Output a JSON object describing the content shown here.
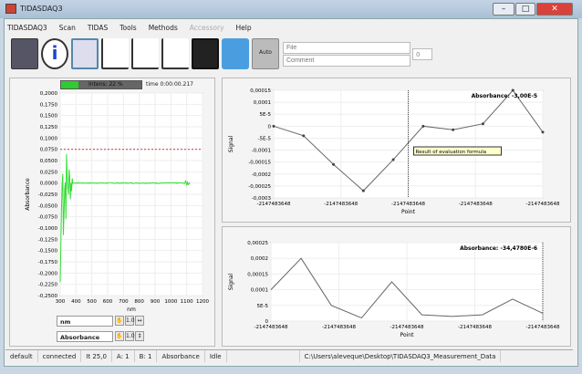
{
  "window": {
    "title": "TIDASDAQ3",
    "minimize": "–",
    "maximize": "□",
    "close": "✕",
    "close_color": "#d9423a"
  },
  "menu": [
    {
      "label": "TIDASDAQ3"
    },
    {
      "label": "Scan"
    },
    {
      "label": "TIDAS"
    },
    {
      "label": "Tools"
    },
    {
      "label": "Methods"
    },
    {
      "label": "Accessory",
      "disabled": true
    },
    {
      "label": "Help"
    }
  ],
  "toolbar": {
    "icons": [
      "spectrometer-icon",
      "info-icon",
      "window-layout-icon",
      "baseline-graph-icon",
      "calibration-curve-icon",
      "spectrum-icon",
      "monitor-icon",
      "folder-icon",
      "auto-button-icon"
    ],
    "auto_label": "Auto",
    "file_placeholder": "File",
    "comment_placeholder": "Comment",
    "counter": "0"
  },
  "left": {
    "progress_label": "Intens: 22 %",
    "progress": 22,
    "progress_color": "#2ecc2e",
    "time_label": "time 0:00:00.217",
    "cursor_rows": [
      {
        "label": "nm",
        "b1": "✋",
        "b2": "1.0",
        "b3": "↔"
      },
      {
        "label": "Absorbance",
        "b1": "✋",
        "b2": "1.0",
        "b3": "↕"
      }
    ]
  },
  "chart_data": [
    {
      "type": "line",
      "xlabel": "nm",
      "ylabel": "Absorbance",
      "xlim": [
        300,
        1200
      ],
      "ylim": [
        -0.25,
        0.2
      ],
      "xticks": [
        "300",
        "400",
        "500",
        "600",
        "700",
        "800",
        "900",
        "1000",
        "1100",
        "1200"
      ],
      "yticks": [
        "0,2000",
        "0,1750",
        "0,1500",
        "0,1250",
        "0,1000",
        "0,0750",
        "0,0500",
        "0,0250",
        "0,0000",
        "-0,0250",
        "-0,0500",
        "-0,0750",
        "-0,1000",
        "-0,1250",
        "-0,1500",
        "-0,1750",
        "-0,2000",
        "-0,2250",
        "-0,2500"
      ],
      "threshold": 0.075,
      "threshold_color": "#c85050",
      "series_color": "#33dd33",
      "grid": true
    },
    {
      "type": "line",
      "xlabel": "Point",
      "ylabel": "Signal",
      "ylim": [
        -0.0003,
        0.00015
      ],
      "xticks": [
        "-2147483648",
        "-2147483648",
        "-2147483648",
        "-2147483648",
        "-2147483648"
      ],
      "yticks": [
        "0,00015",
        "0,0001",
        "5E-5",
        "0",
        "-5E-5",
        "-0,0001",
        "-0,00015",
        "-0,0002",
        "-0,00025",
        "-0,0003"
      ],
      "values": [
        0,
        -4e-05,
        -0.00016,
        -0.00027,
        -0.00014,
        0,
        -1.5e-05,
        1e-05,
        0.00015,
        -2.5e-05
      ],
      "legend": "Absorbance: -3,00E-5",
      "annotation": "Result of evaluation formula",
      "cursor_index": 4.5,
      "grid": true
    },
    {
      "type": "line",
      "xlabel": "Point",
      "ylabel": "Signal",
      "ylim": [
        0,
        0.00025
      ],
      "xticks": [
        "-2147483648",
        "-2147483648",
        "-2147483648",
        "-2147483648",
        "-2147483648"
      ],
      "yticks": [
        "0,00025",
        "0,0002",
        "0,00015",
        "0,0001",
        "5E-5",
        "0"
      ],
      "values": [
        0.0001,
        0.0002,
        5e-05,
        1e-05,
        0.000125,
        2e-05,
        1.5e-05,
        2e-05,
        7e-05,
        2.5e-05
      ],
      "legend": "Absorbance: -34,4780E-6",
      "cursor_index": 9,
      "grid": true
    }
  ],
  "status": [
    "default",
    "connected",
    "It 25,0",
    "A: 1",
    "B: 1",
    "Absorbance",
    "Idle",
    "",
    "C:\\Users\\aleveque\\Desktop\\TIDASDAQ3_Measurement_Data"
  ]
}
